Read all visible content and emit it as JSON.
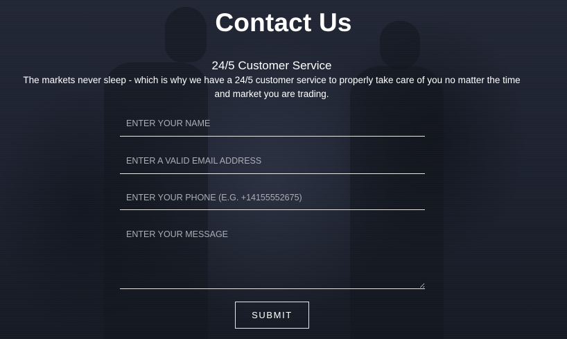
{
  "header": {
    "title": "Contact Us",
    "subtitle": "24/5 Customer Service",
    "description": "The markets never sleep - which is why we have a 24/5 customer service to properly take care of you no matter the time and market you are trading."
  },
  "form": {
    "name_placeholder": "ENTER YOUR NAME",
    "email_placeholder": "ENTER A VALID EMAIL ADDRESS",
    "phone_placeholder": "ENTER YOUR PHONE (E.G. +14155552675)",
    "message_placeholder": "ENTER YOUR MESSAGE",
    "name_value": "",
    "email_value": "",
    "phone_value": "",
    "message_value": "",
    "submit_label": "SUBMIT"
  },
  "colors": {
    "background": "#1e2330",
    "text": "#ffffff",
    "placeholder": "#a9adb6",
    "border": "#e6e6e6"
  }
}
